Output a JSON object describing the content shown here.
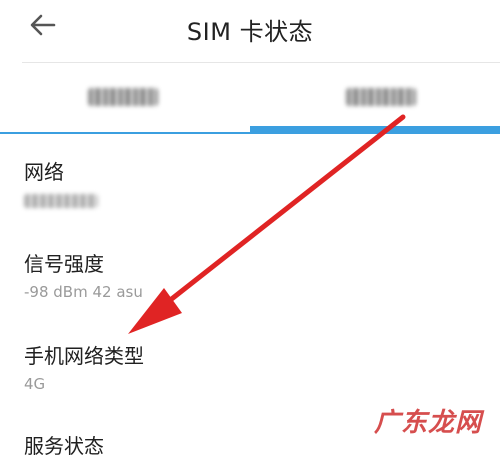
{
  "header": {
    "title": "SIM  卡状态"
  },
  "tabs": [
    {
      "label": "",
      "selected": false
    },
    {
      "label": "",
      "selected": true
    }
  ],
  "items": [
    {
      "label": "网络",
      "value": ""
    },
    {
      "label": "信号强度",
      "value": "-98 dBm 42 asu"
    },
    {
      "label": "手机网络类型",
      "value": "4G"
    },
    {
      "label": "服务状态",
      "value": ""
    }
  ],
  "watermark": {
    "text": "广东龙网"
  },
  "colors": {
    "accent": "#3b9fe0",
    "arrow": "#e02424"
  }
}
